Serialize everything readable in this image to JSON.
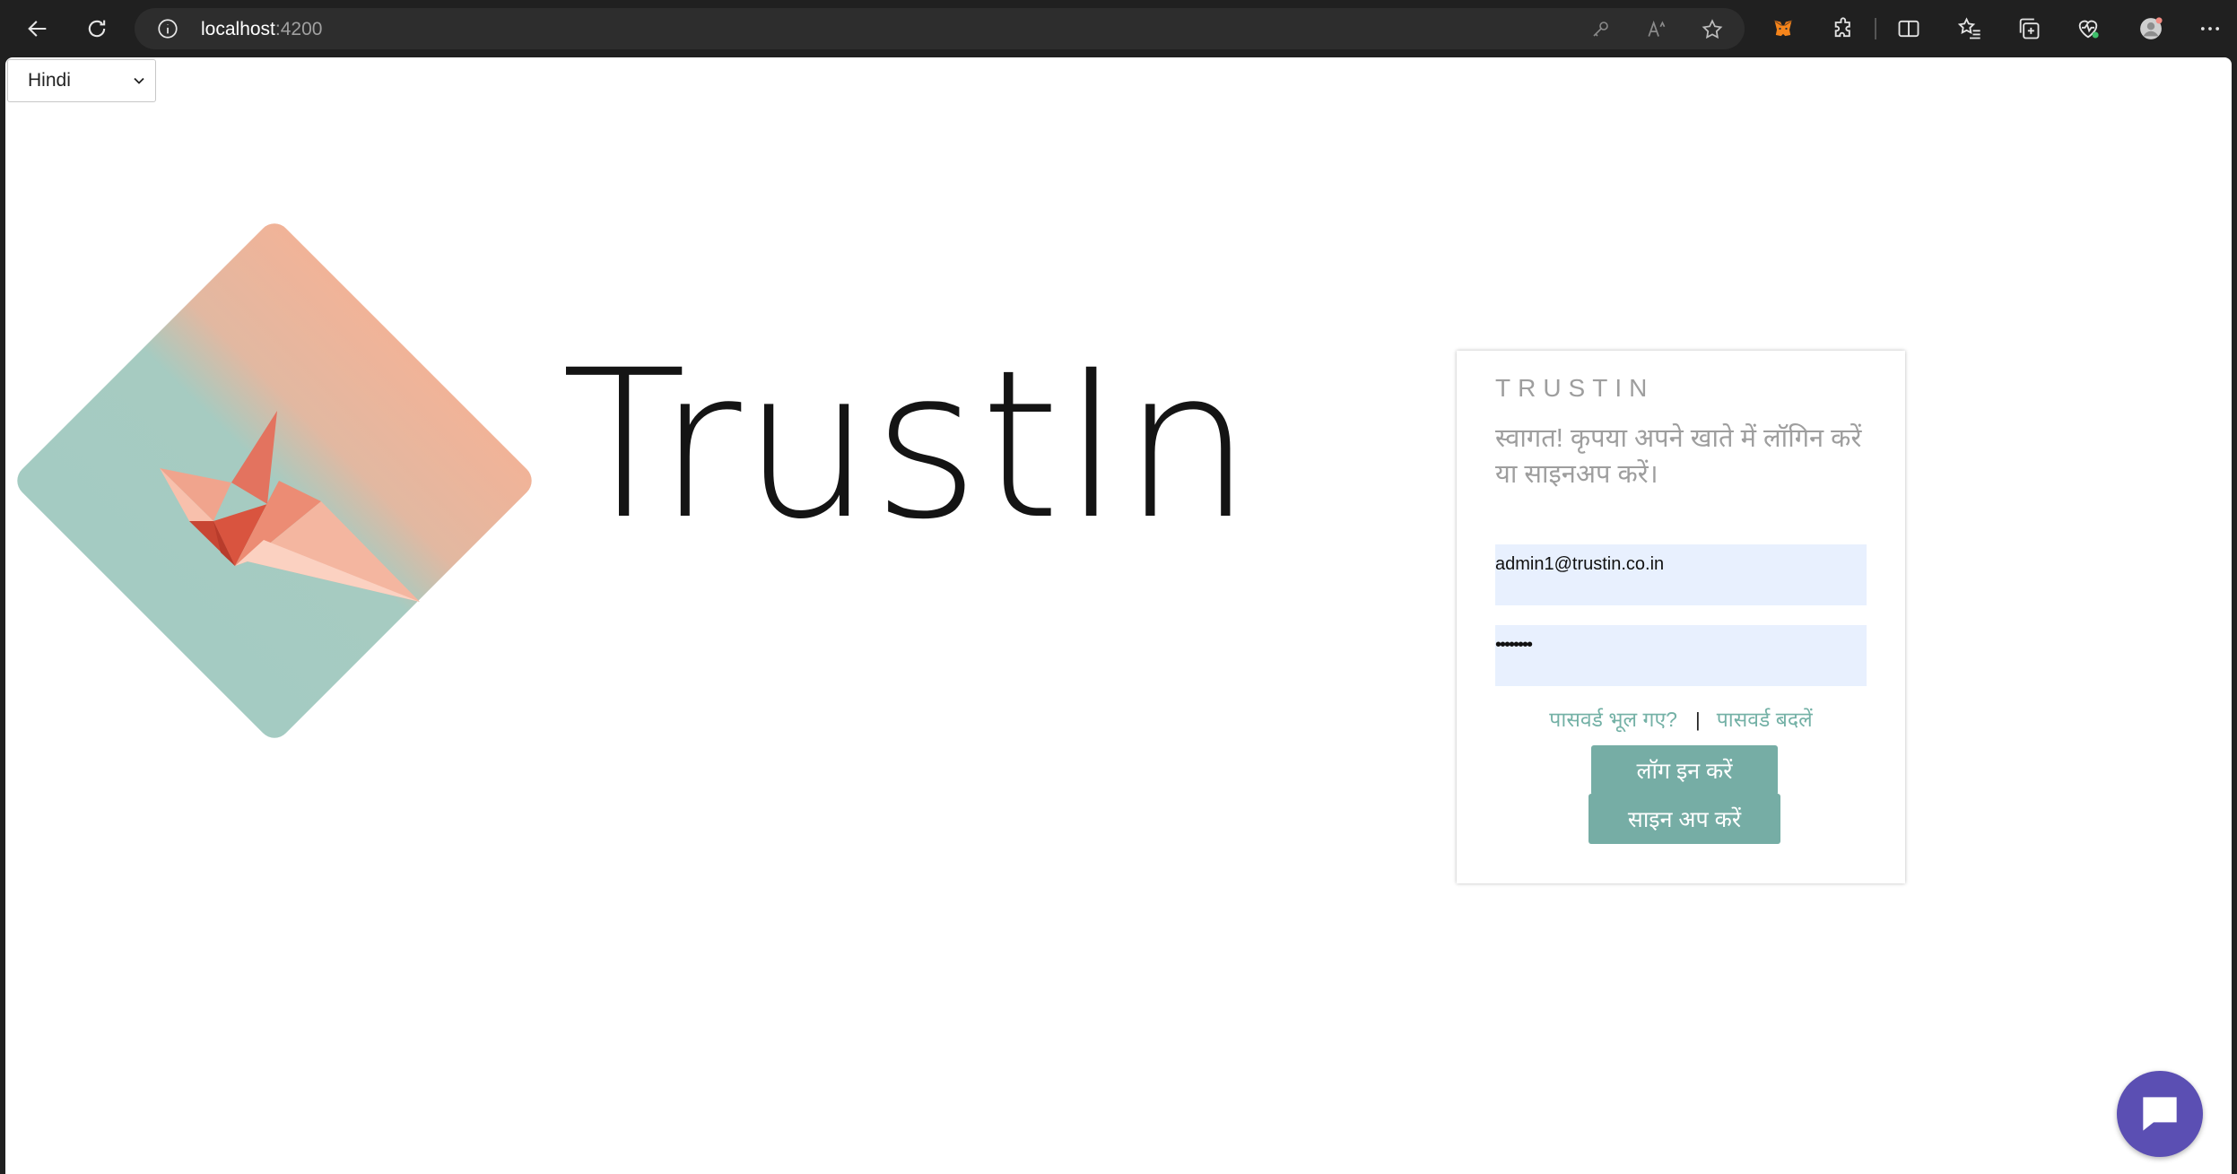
{
  "browser": {
    "url_host": "localhost",
    "url_port": ":4200"
  },
  "language_select": {
    "selected": "Hindi"
  },
  "logo": {
    "wordmark": "TrustIn",
    "colors": {
      "peach": "#eeb49a",
      "teal": "#a4ccc2",
      "crane": "#e56a54"
    }
  },
  "login": {
    "brand": "TRUSTIN",
    "welcome": "स्वागत! कृपया अपने खाते में लॉगिन करें या साइनअप करें।",
    "email_value": "admin1@trustin.co.in",
    "password_mask": "••••••••",
    "forgot_password": "पासवर्ड भूल गए?",
    "separator": "|",
    "change_password": "पासवर्ड बदलें",
    "login_button": "लॉग इन करें",
    "signup_button": "साइन अप करें",
    "accent_color": "#76ada5"
  }
}
